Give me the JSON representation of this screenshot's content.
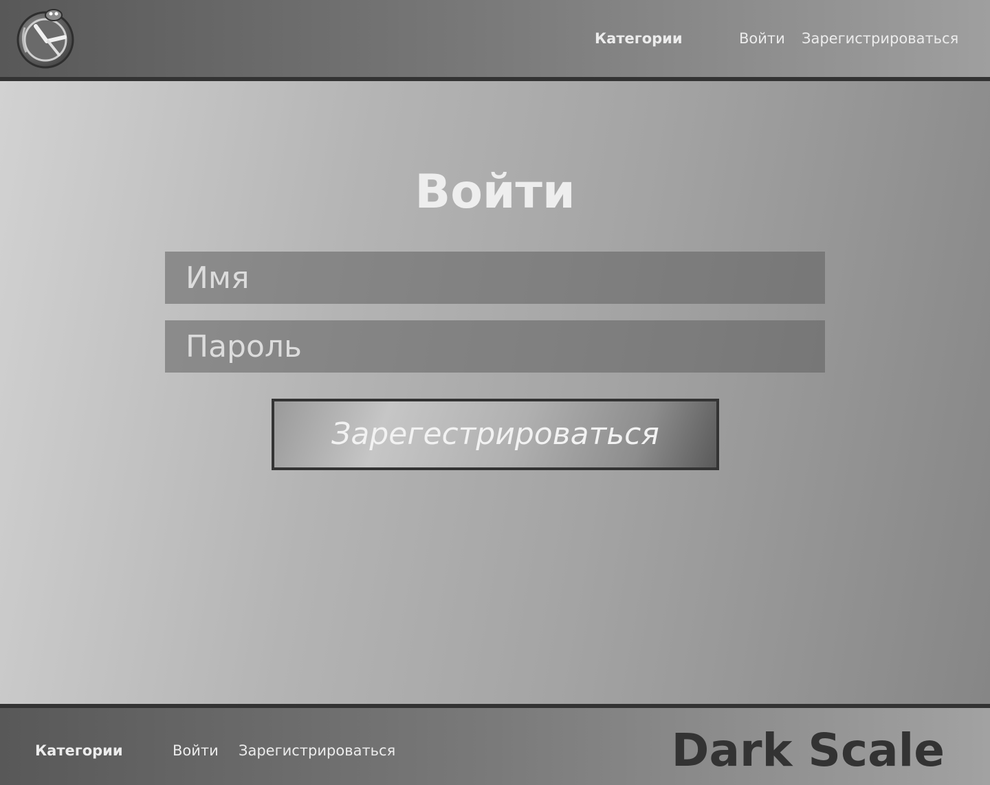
{
  "header": {
    "logo_icon": "clock-snake-logo-icon",
    "nav": {
      "categories": "Категории",
      "login": "Войти",
      "register": "Зарегистрироваться"
    }
  },
  "main": {
    "title": "Войти",
    "name_placeholder": "Имя",
    "password_placeholder": "Пароль",
    "submit_label": "Зарегестрироваться"
  },
  "footer": {
    "nav": {
      "categories": "Категории",
      "login": "Войти",
      "register": "Зарегистрироваться"
    },
    "brand": "Dark Scale"
  },
  "colors": {
    "header_bg_start": "#585858",
    "header_bg_end": "#9f9f9f",
    "border_dark": "#333333",
    "text_light": "#ececec",
    "brand_text": "#333333"
  }
}
